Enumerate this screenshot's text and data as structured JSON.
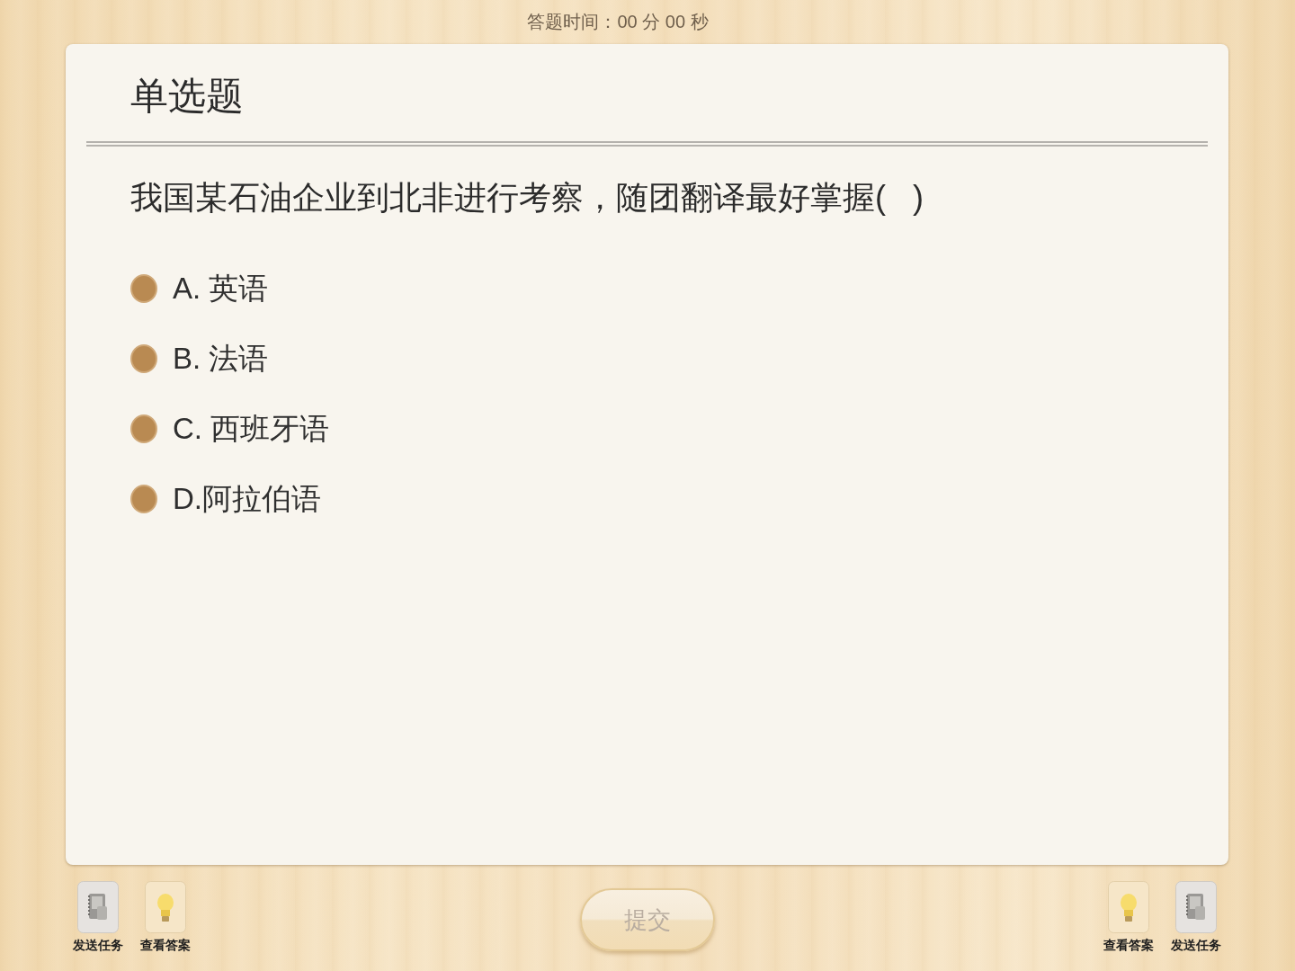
{
  "timer": "答题时间：00 分 00 秒",
  "card": {
    "title": "单选题",
    "question": "我国某石油企业到北非进行考察，随团翻译最好掌握(   )",
    "options": [
      {
        "label": "A. 英语",
        "selected": false
      },
      {
        "label": "B. 法语",
        "selected": false
      },
      {
        "label": "C. 西班牙语",
        "selected": false
      },
      {
        "label": "D.阿拉伯语",
        "selected": false
      }
    ]
  },
  "left_tools": [
    {
      "kind": "send",
      "label": "发送任务"
    },
    {
      "kind": "answer",
      "label": "查看答案"
    }
  ],
  "submit": {
    "label": "提交",
    "disabled": true
  },
  "right_tools": [
    {
      "kind": "answer",
      "label": "查看答案"
    },
    {
      "kind": "send",
      "label": "发送任务"
    }
  ]
}
